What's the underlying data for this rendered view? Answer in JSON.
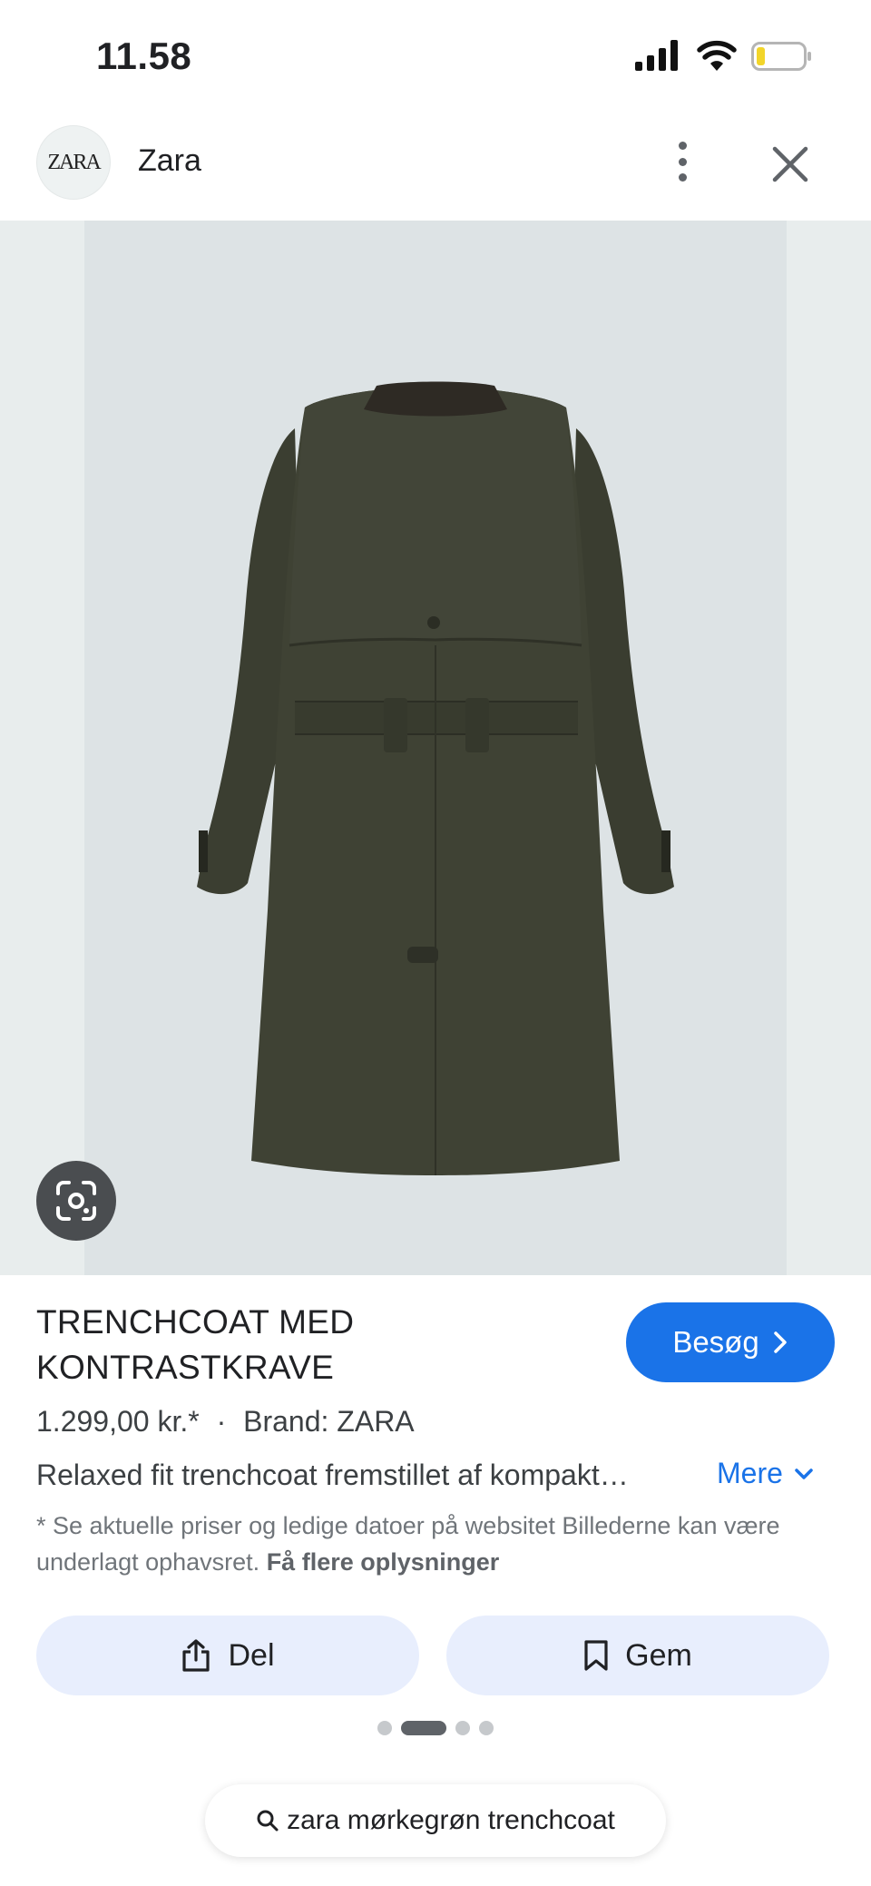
{
  "status_bar": {
    "time": "11.58"
  },
  "header": {
    "logo_text": "ZARA",
    "site_name": "Zara"
  },
  "product": {
    "title": "TRENCHCOAT MED KONTRASTKRAVE",
    "price": "1.299,00 kr.*",
    "separator": "·",
    "brand": "Brand: ZARA",
    "description": "Relaxed fit trenchcoat fremstillet af kompakt…",
    "more_label": "Mere",
    "disclaimer_text": "* Se aktuelle priser og ledige datoer på websitet Billederne kan være underlagt ophavsret.",
    "disclaimer_link": "Få flere oplysninger"
  },
  "buttons": {
    "visit_label": "Besøg",
    "share_label": "Del",
    "save_label": "Gem"
  },
  "carousel": {
    "total": 4,
    "active_index": 1
  },
  "search": {
    "query": "zara mørkegrøn trenchcoat"
  },
  "colors": {
    "accent": "#1a73e8",
    "button_bg": "#e8eefd",
    "coat": "#3f4234",
    "collar": "#2e2a24"
  },
  "icons": [
    "signal-icon",
    "wifi-icon",
    "battery-icon",
    "more-vert-icon",
    "close-icon",
    "lens-icon",
    "chevron-right-icon",
    "chevron-down-icon",
    "share-icon",
    "bookmark-icon",
    "search-icon"
  ]
}
